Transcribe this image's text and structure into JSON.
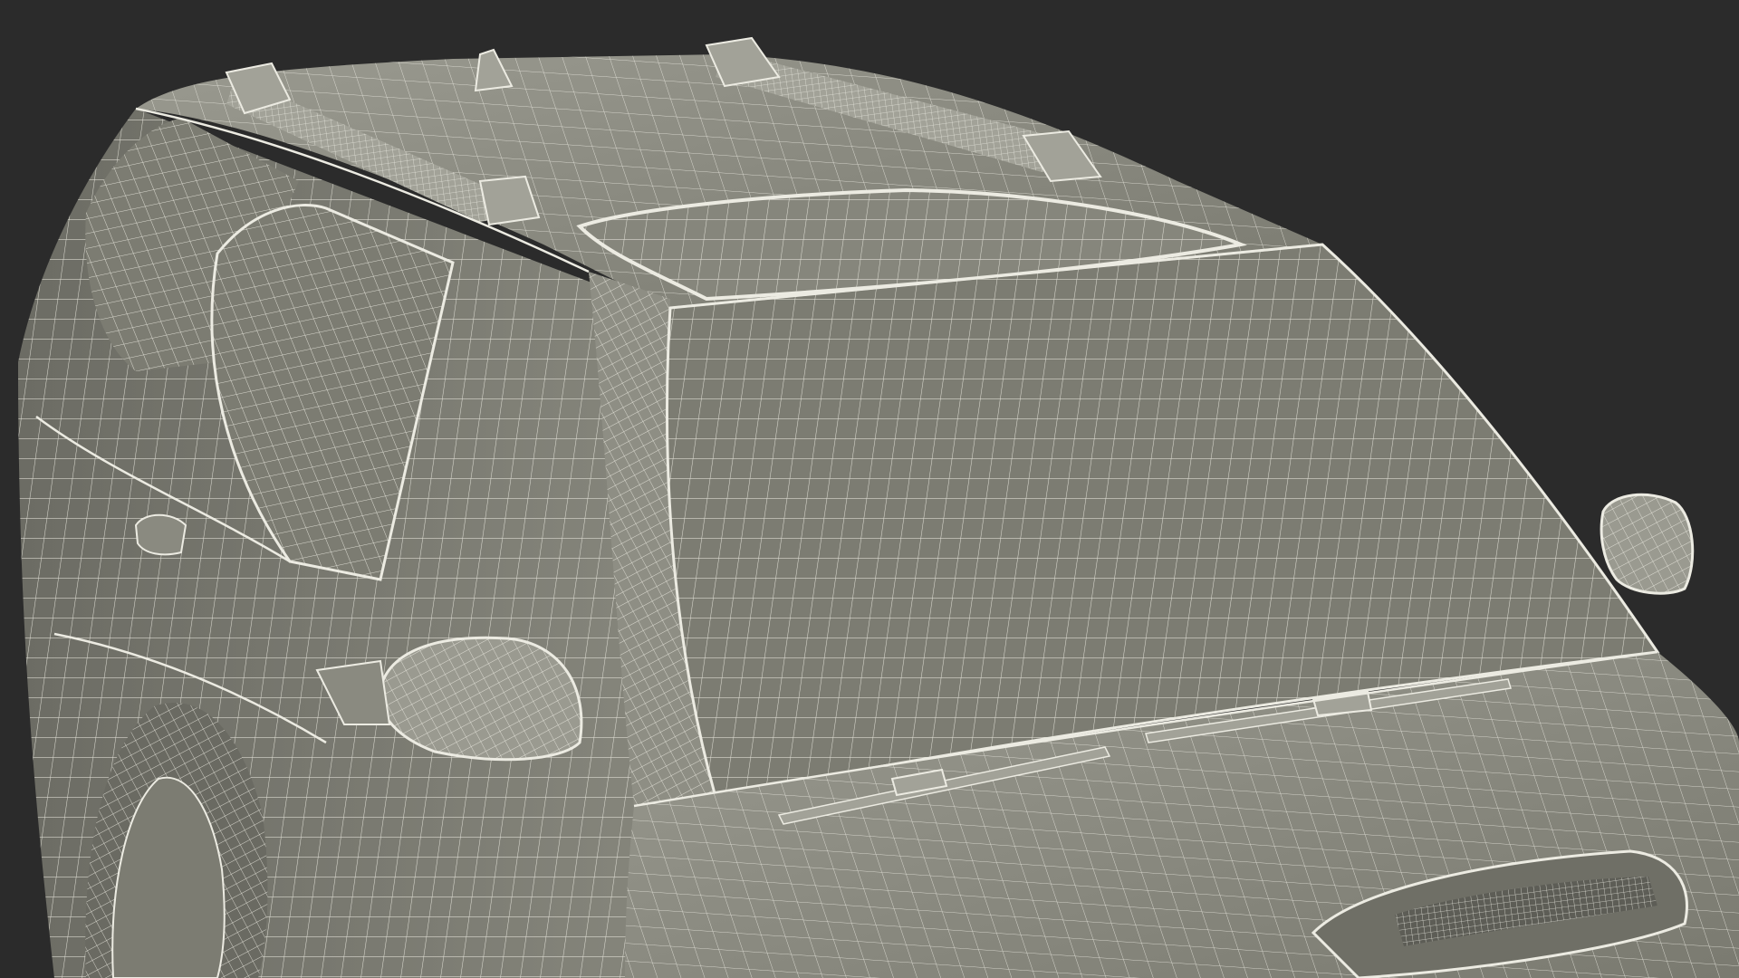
{
  "scene": {
    "subject": "suv-wireframe-render",
    "background_color": "#2b2b2b",
    "body_color": "#8a8a80",
    "body_shadow_color": "#6f6f66",
    "body_highlight_color": "#a2a298",
    "wire_color": "#ecebe2",
    "glass_color": "#7c7c72"
  }
}
